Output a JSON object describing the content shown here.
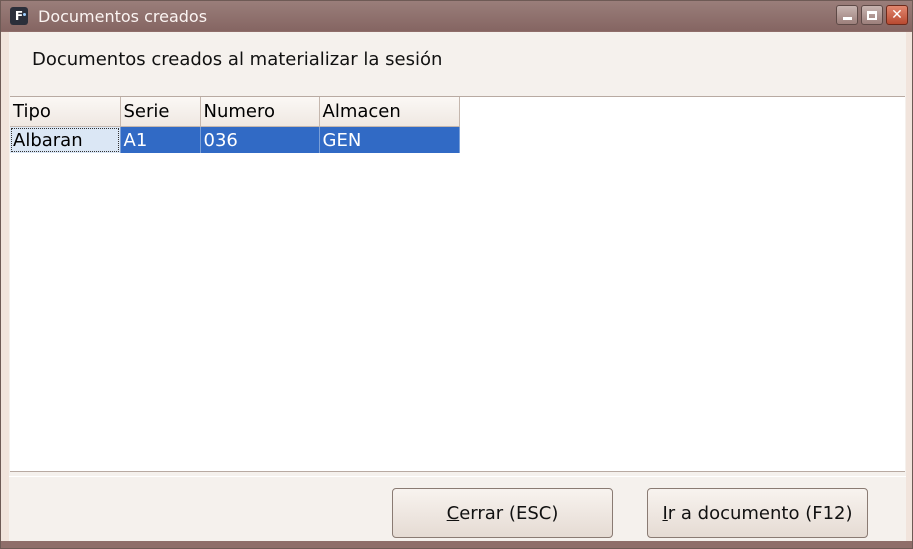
{
  "window": {
    "title": "Documentos creados",
    "app_icon_letter": "F"
  },
  "dialog": {
    "heading": "Documentos creados al materializar la sesión"
  },
  "grid": {
    "columns": [
      "Tipo",
      "Serie",
      "Numero",
      "Almacen"
    ],
    "rows": [
      [
        "Albaran",
        "A1",
        "036",
        "GEN"
      ]
    ],
    "selected_row": 0,
    "selection_color": "#316ac5"
  },
  "buttons": {
    "close": {
      "mnemonic": "C",
      "rest": "errar (ESC)"
    },
    "goto": {
      "mnemonic": "I",
      "rest": "r a documento (F12)"
    }
  },
  "colors": {
    "titlebar": "#8f6e6a",
    "close_button": "#c85a40",
    "client_bg": "#f5f1ed"
  },
  "icons": {
    "minimize": "minimize-icon",
    "maximize": "maximize-icon",
    "close": "close-icon"
  }
}
